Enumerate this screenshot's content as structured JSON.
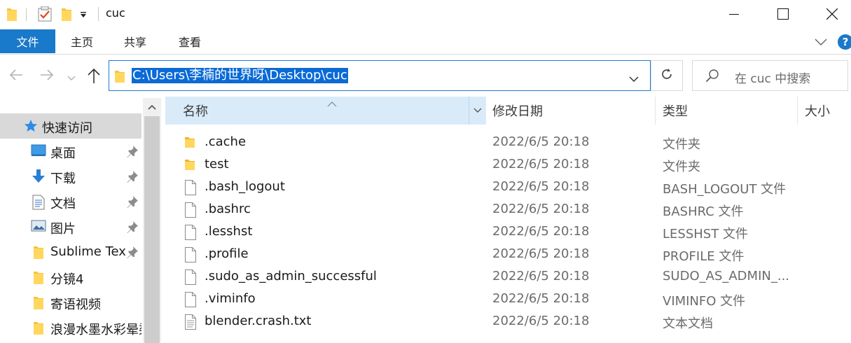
{
  "window": {
    "title": "cuc"
  },
  "ribbon": {
    "tabs": [
      {
        "label": "文件"
      },
      {
        "label": "主页"
      },
      {
        "label": "共享"
      },
      {
        "label": "查看"
      }
    ],
    "help_label": "?"
  },
  "address": {
    "path": "C:\\Users\\李楠的世界呀\\Desktop\\cuc",
    "search_placeholder": "在 cuc 中搜索"
  },
  "nav_pane": {
    "items": [
      {
        "label": "快速访问",
        "icon": "star-icon"
      },
      {
        "label": "桌面",
        "icon": "desktop-icon",
        "pinned": true
      },
      {
        "label": "下载",
        "icon": "download-icon",
        "pinned": true
      },
      {
        "label": "文档",
        "icon": "document-icon",
        "pinned": true
      },
      {
        "label": "图片",
        "icon": "pictures-icon",
        "pinned": true
      },
      {
        "label": "Sublime Text",
        "icon": "folder-icon",
        "pinned": true
      },
      {
        "label": "分镜4",
        "icon": "folder-icon"
      },
      {
        "label": "寄语视频",
        "icon": "folder-icon"
      },
      {
        "label": "浪漫水墨水彩晕染",
        "icon": "folder-icon"
      }
    ]
  },
  "file_list": {
    "columns": {
      "name": "名称",
      "modified": "修改日期",
      "type": "类型",
      "size": "大小"
    },
    "rows": [
      {
        "name": ".cache",
        "modified": "2022/6/5 20:18",
        "type": "文件夹",
        "icon": "folder-icon"
      },
      {
        "name": "test",
        "modified": "2022/6/5 20:18",
        "type": "文件夹",
        "icon": "folder-icon"
      },
      {
        "name": ".bash_logout",
        "modified": "2022/6/5 20:18",
        "type": "BASH_LOGOUT 文件",
        "icon": "file-icon"
      },
      {
        "name": ".bashrc",
        "modified": "2022/6/5 20:18",
        "type": "BASHRC 文件",
        "icon": "file-icon"
      },
      {
        "name": ".lesshst",
        "modified": "2022/6/5 20:18",
        "type": "LESSHST 文件",
        "icon": "file-icon"
      },
      {
        "name": ".profile",
        "modified": "2022/6/5 20:18",
        "type": "PROFILE 文件",
        "icon": "file-icon"
      },
      {
        "name": ".sudo_as_admin_successful",
        "modified": "2022/6/5 20:18",
        "type": "SUDO_AS_ADMIN_...",
        "icon": "file-icon"
      },
      {
        "name": ".viminfo",
        "modified": "2022/6/5 20:18",
        "type": "VIMINFO 文件",
        "icon": "file-icon"
      },
      {
        "name": "blender.crash.txt",
        "modified": "2022/6/5 20:18",
        "type": "文本文档",
        "icon": "text-file-icon"
      }
    ]
  },
  "colors": {
    "accent": "#1979ca",
    "selection": "#0a6ad6",
    "folder": "#f3c63f"
  }
}
